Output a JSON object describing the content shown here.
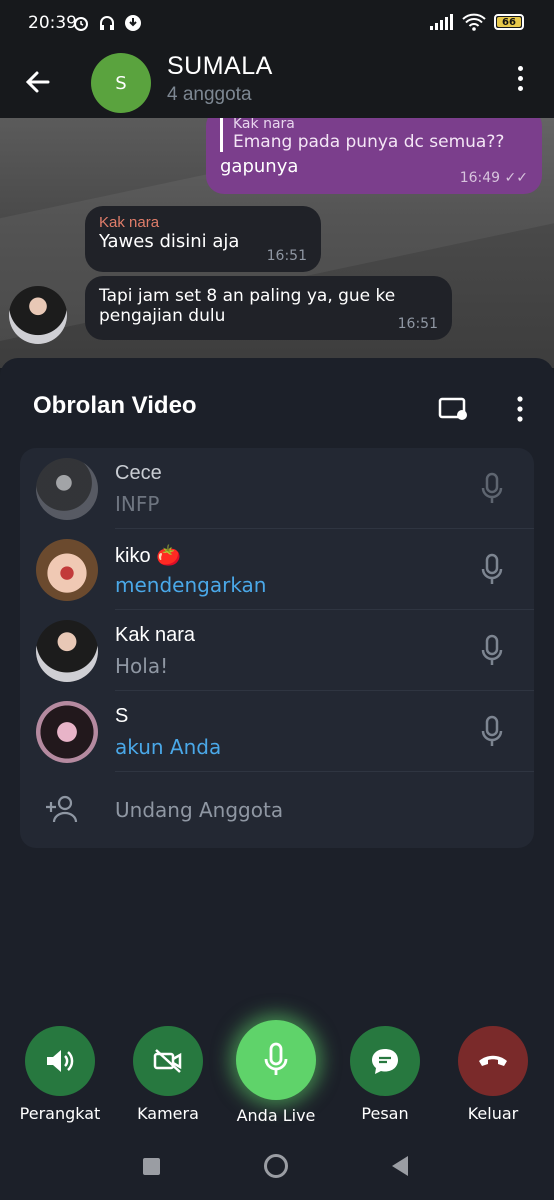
{
  "status_bar": {
    "time": "20:39",
    "battery": "66"
  },
  "header": {
    "group_initial": "S",
    "group_name": "SUMALA",
    "group_subtitle": "4 anggota"
  },
  "chat": {
    "outgoing": {
      "quote_name": "Kak nara",
      "quote_text": "Emang pada punya dc semua??",
      "text": "gapunya",
      "time": "16:49"
    },
    "incoming_1": {
      "sender": "Kak nara",
      "text": "Yawes disini aja",
      "time": "16:51"
    },
    "incoming_2": {
      "text_line1": "Tapi jam set 8 an paling ya, gue ke",
      "text_line2": "pengajian dulu",
      "time": "16:51"
    }
  },
  "video_chat": {
    "title": "Obrolan Video",
    "participants": [
      {
        "name": "Cece",
        "status": "INFP",
        "status_color": "gray"
      },
      {
        "name": "kiko 🍅",
        "status": "mendengarkan",
        "status_color": "blue"
      },
      {
        "name": "Kak nara",
        "status": "Hola!",
        "status_color": "gray"
      },
      {
        "name": "S",
        "status": "akun Anda",
        "status_color": "blue"
      }
    ],
    "invite_label": "Undang Anggota"
  },
  "controls": [
    {
      "label": "Perangkat",
      "icon": "speaker-icon"
    },
    {
      "label": "Kamera",
      "icon": "camera-off-icon"
    },
    {
      "label": "Anda Live",
      "icon": "mic-icon"
    },
    {
      "label": "Pesan",
      "icon": "message-icon"
    },
    {
      "label": "Keluar",
      "icon": "hangup-icon"
    }
  ],
  "colors": {
    "accent_blue": "#4aa8e8",
    "live_green": "#5fd36a",
    "control_green": "#27783f",
    "leave_red": "#7a2a2a",
    "sheet_bg": "#1c2029"
  }
}
